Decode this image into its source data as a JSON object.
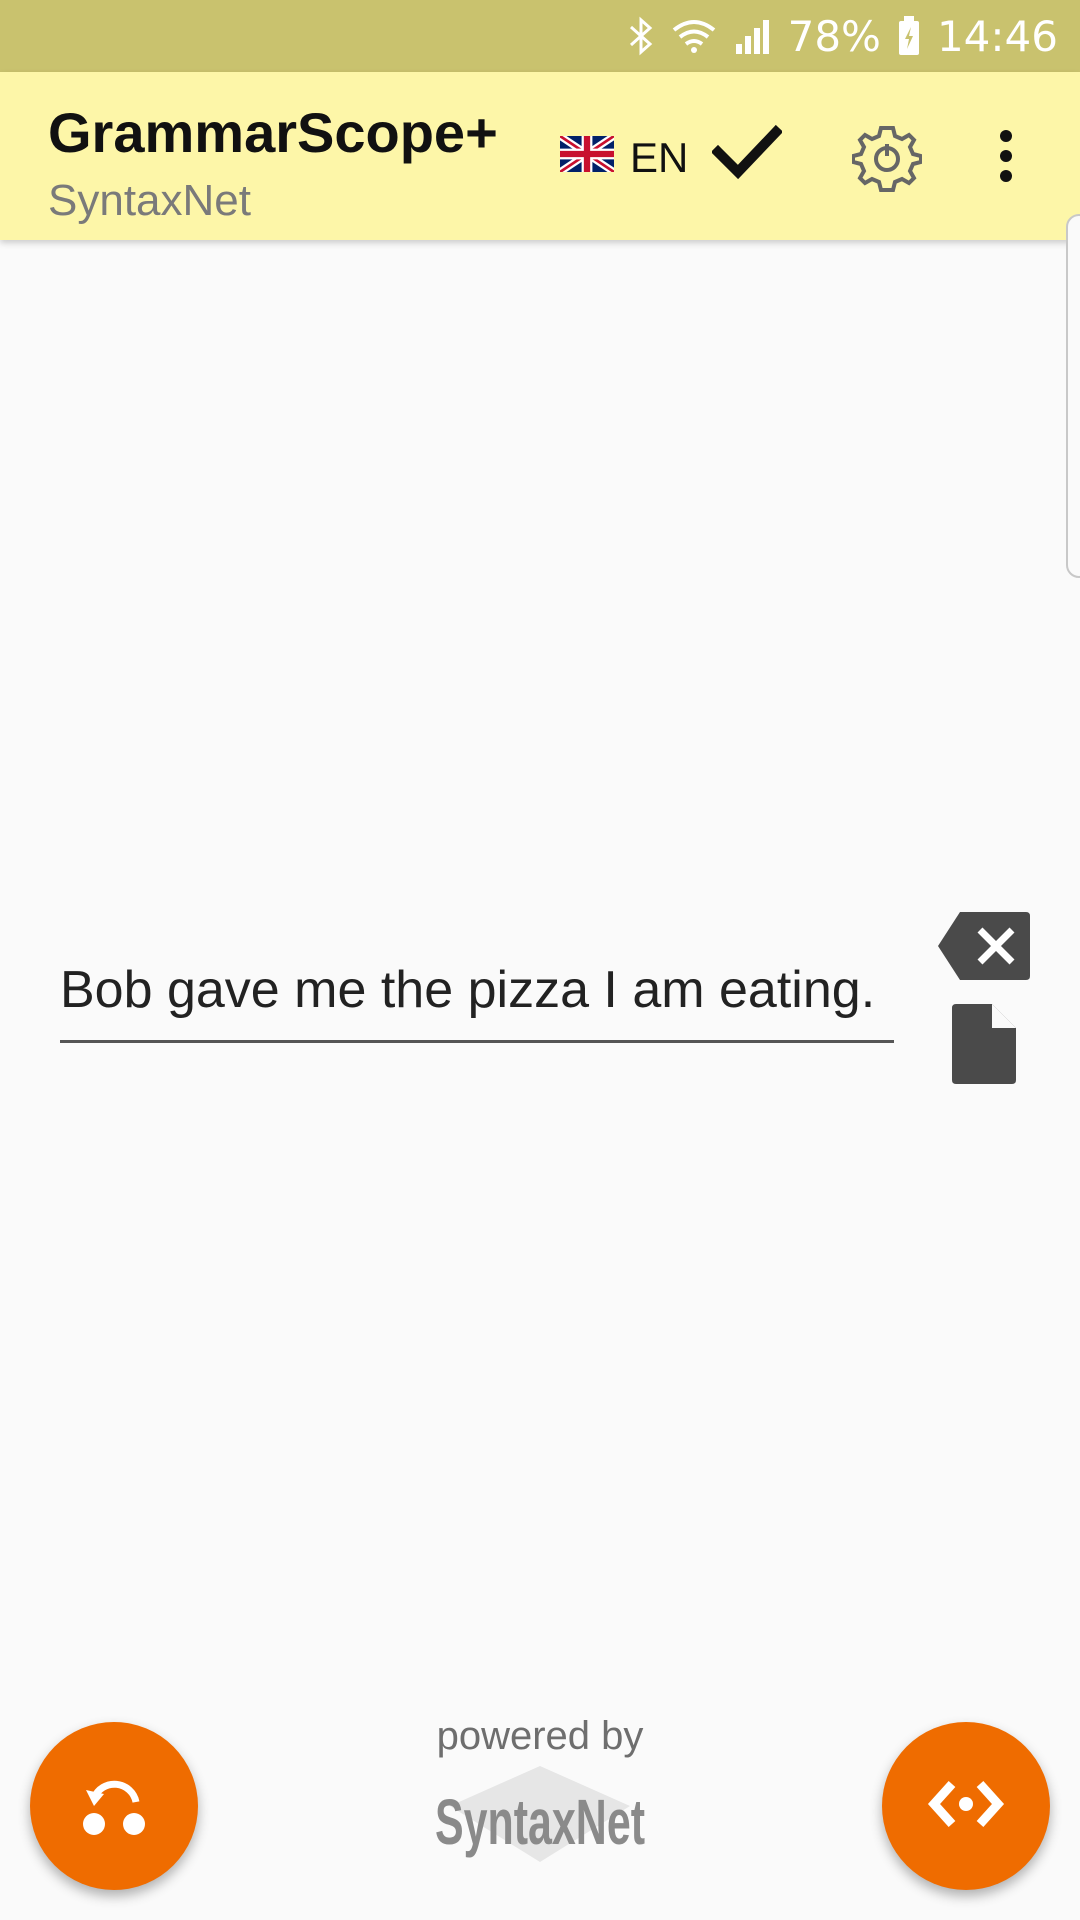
{
  "status_bar": {
    "battery": "78%",
    "time": "14:46"
  },
  "app_bar": {
    "title": "GrammarScope+",
    "subtitle": "SyntaxNet",
    "language": "EN"
  },
  "input": {
    "text": "Bob gave me the pizza I am eating."
  },
  "footer": {
    "powered_by": "powered by",
    "logo_text": "SyntaxNet"
  },
  "colors": {
    "accent": "#ef6c00",
    "appbar": "#fdf6a8",
    "statusbar": "#c9c26e"
  },
  "icons": [
    "bluetooth-icon",
    "wifi-icon",
    "signal-icon",
    "battery-icon",
    "uk-flag-icon",
    "check-icon",
    "gear-icon",
    "more-vert-icon",
    "clear-icon",
    "document-icon",
    "rotate-icon",
    "code-icon"
  ]
}
